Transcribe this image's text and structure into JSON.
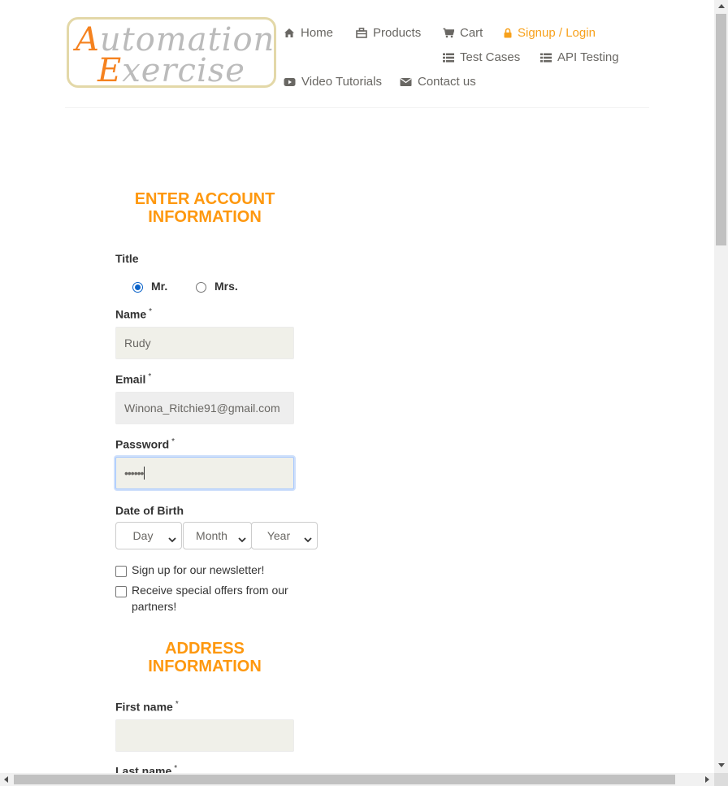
{
  "logo": {
    "line1_cap": "A",
    "line1_rest": "utomation",
    "line2_cap": "E",
    "line2_rest": "xercise"
  },
  "nav": {
    "home": "Home",
    "products": "Products",
    "cart": "Cart",
    "signup_login": "Signup / Login",
    "test_cases": "Test Cases",
    "api_testing": "API Testing",
    "video_tutorials": "Video Tutorials",
    "contact_us": "Contact us"
  },
  "account_section": {
    "title": "ENTER ACCOUNT INFORMATION",
    "title_label": "Title",
    "title_options": [
      {
        "label": "Mr.",
        "checked": true
      },
      {
        "label": "Mrs.",
        "checked": false
      }
    ],
    "name_label": "Name",
    "name_value": "Rudy",
    "email_label": "Email",
    "email_value": "Winona_Ritchie91@gmail.com",
    "password_label": "Password",
    "password_value": "••••••",
    "dob_label": "Date of Birth",
    "dob_day": "Day",
    "dob_month": "Month",
    "dob_year": "Year",
    "newsletter_label": "Sign up for our newsletter!",
    "offers_label": "Receive special offers from our partners!",
    "required_mark": "*"
  },
  "address_section": {
    "title": "ADDRESS INFORMATION",
    "first_name_label": "First name",
    "first_name_value": "",
    "last_name_label": "Last name"
  },
  "colors": {
    "accent": "#fe980f",
    "nav_text": "#696763",
    "active_nav": "#f7a11c",
    "input_bg": "#f0f0e9",
    "radio": "#0b63c9"
  }
}
